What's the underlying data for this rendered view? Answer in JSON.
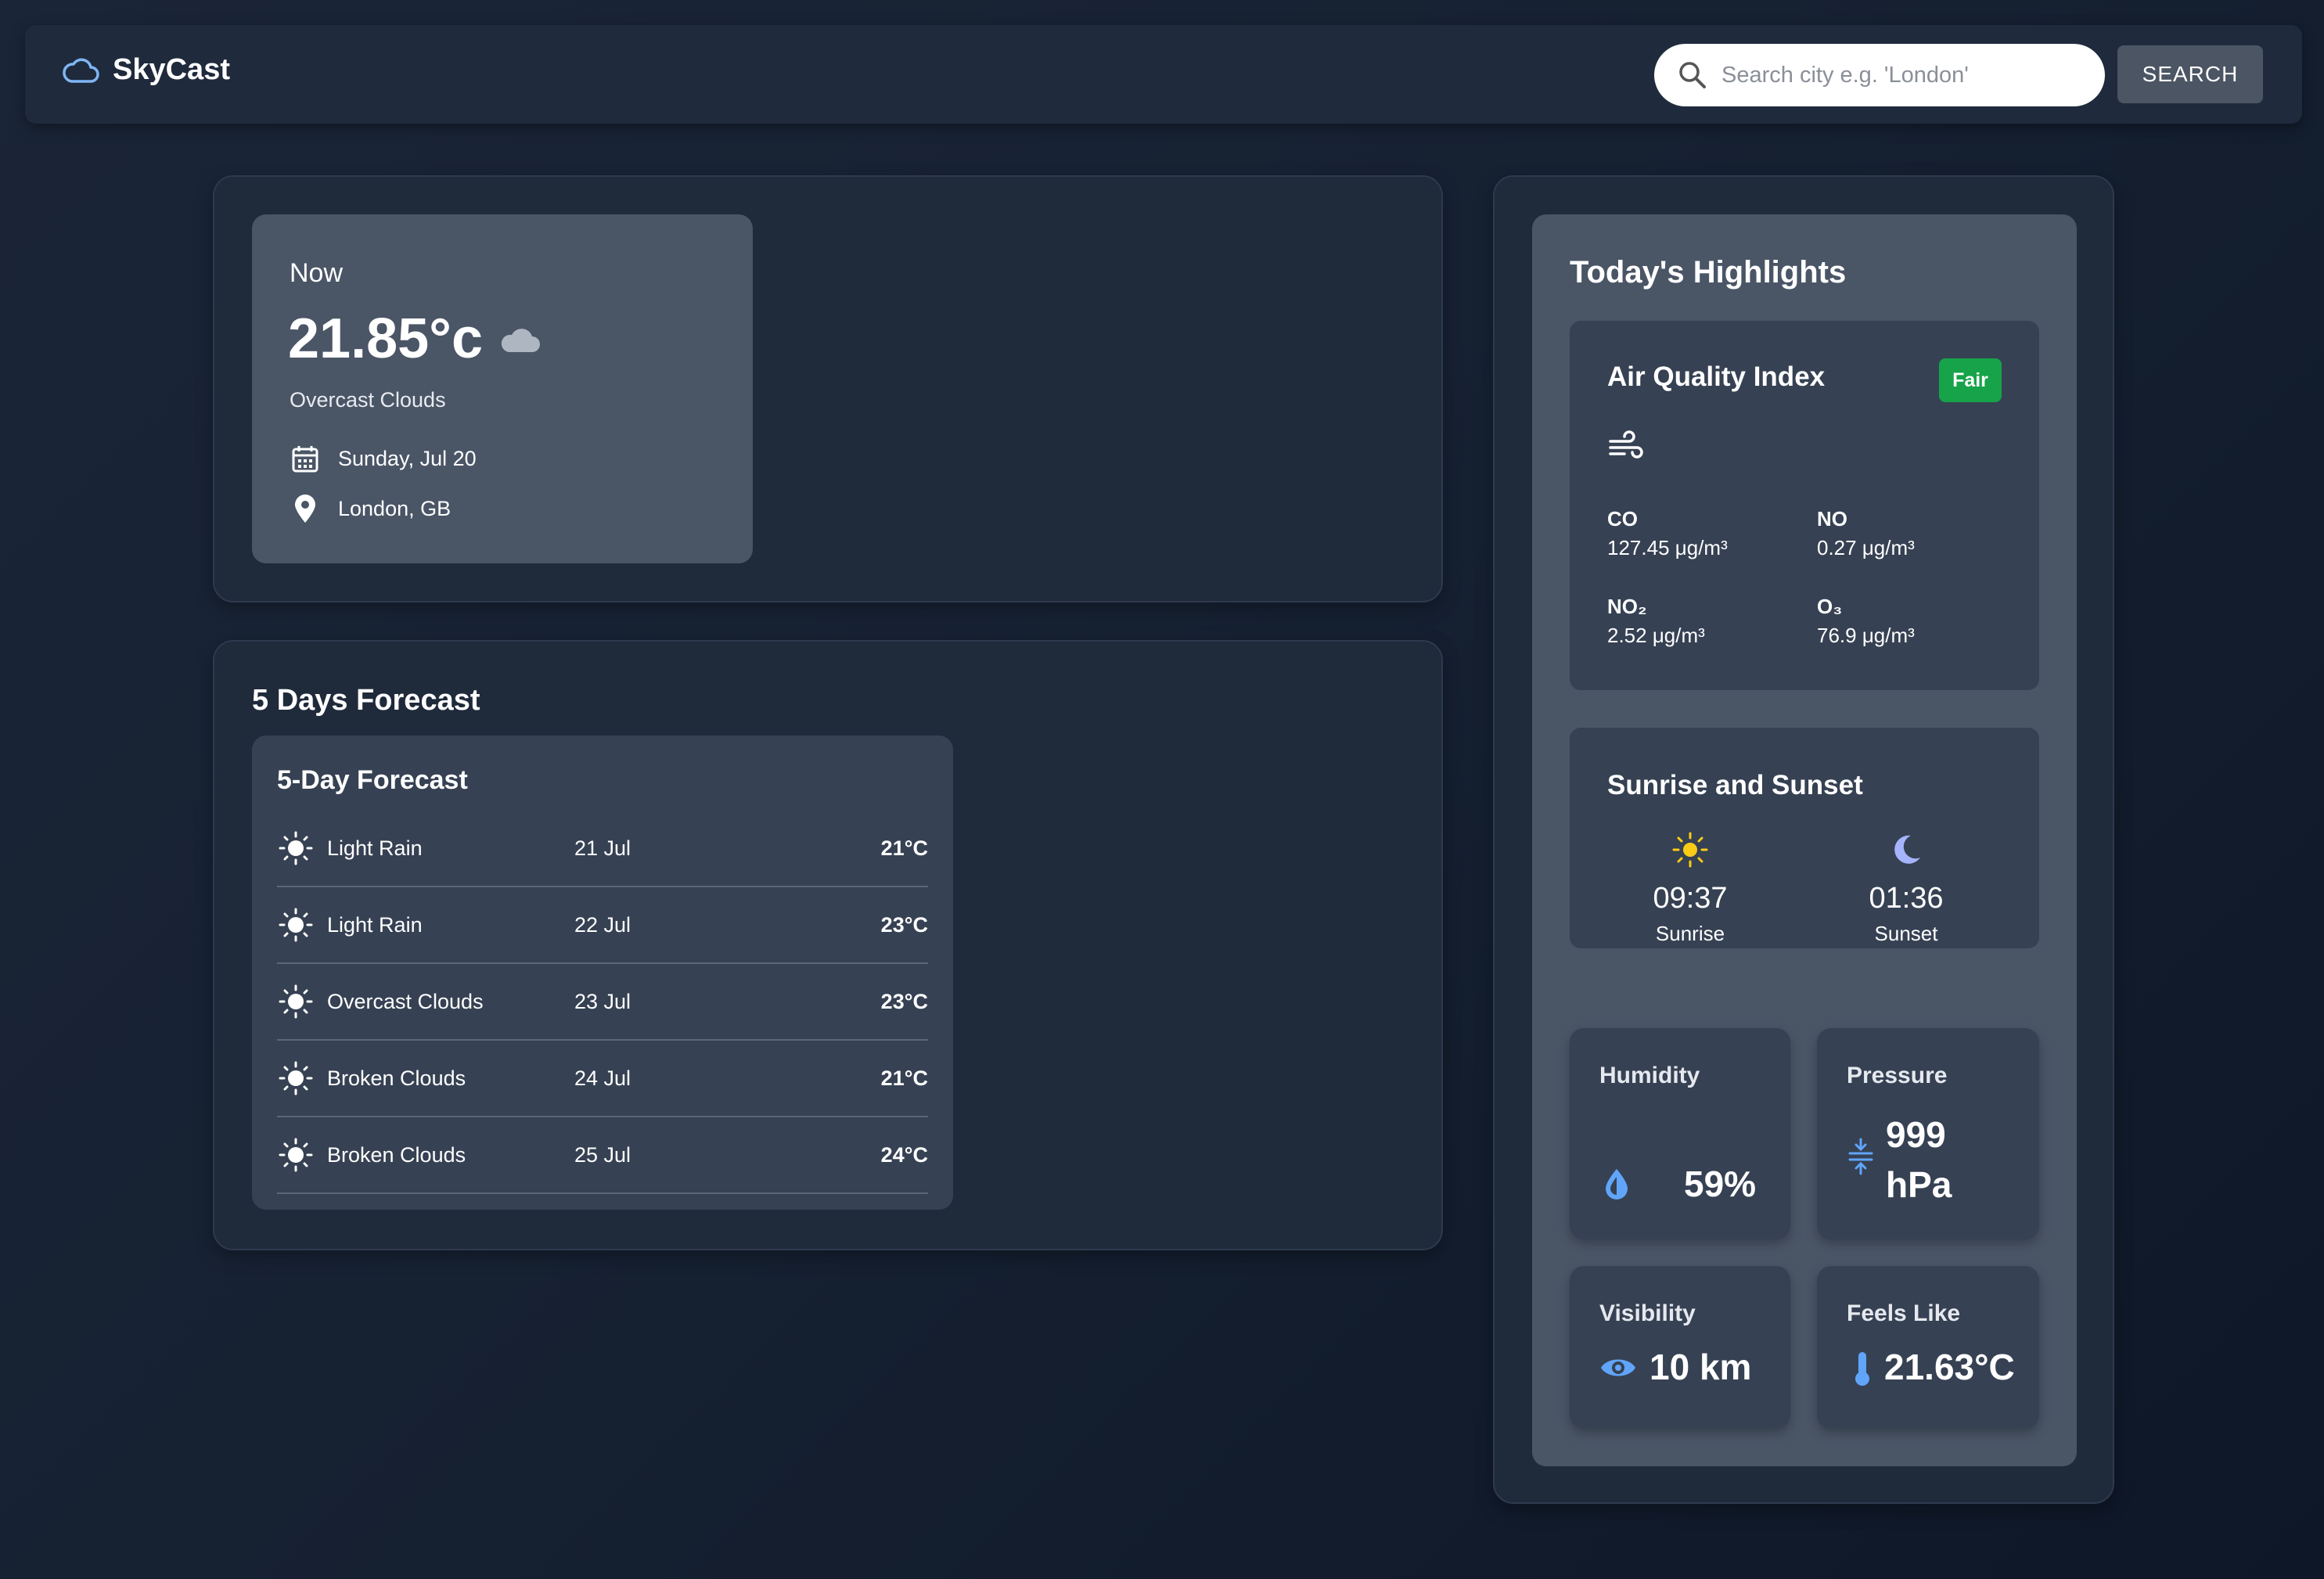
{
  "app": {
    "name": "SkyCast"
  },
  "search": {
    "placeholder": "Search city e.g. 'London'",
    "button_label": "SEARCH"
  },
  "current": {
    "heading": "Now",
    "temperature": "21.85°c",
    "description": "Overcast Clouds",
    "date": "Sunday, Jul 20",
    "location": "London, GB"
  },
  "forecast_section": {
    "title": "5 Days Forecast",
    "card_title": "5-Day Forecast",
    "days": [
      {
        "description": "Light Rain",
        "date": "21 Jul",
        "temp": "21°C"
      },
      {
        "description": "Light Rain",
        "date": "22 Jul",
        "temp": "23°C"
      },
      {
        "description": "Overcast Clouds",
        "date": "23 Jul",
        "temp": "23°C"
      },
      {
        "description": "Broken Clouds",
        "date": "24 Jul",
        "temp": "21°C"
      },
      {
        "description": "Broken Clouds",
        "date": "25 Jul",
        "temp": "24°C"
      }
    ]
  },
  "highlights": {
    "title": "Today's Highlights",
    "air_quality": {
      "title": "Air Quality Index",
      "badge": "Fair",
      "badge_color": "#16a34a",
      "pollutants": [
        {
          "name": "CO",
          "value": "127.45 μg/m³"
        },
        {
          "name": "NO",
          "value": "0.27 μg/m³"
        },
        {
          "name": "NO₂",
          "value": "2.52 μg/m³"
        },
        {
          "name": "O₃",
          "value": "76.9 μg/m³"
        }
      ]
    },
    "sun": {
      "title": "Sunrise and Sunset",
      "sunrise_time": "09:37",
      "sunrise_label": "Sunrise",
      "sunset_time": "01:36",
      "sunset_label": "Sunset"
    },
    "humidity": {
      "label": "Humidity",
      "value": "59%"
    },
    "pressure": {
      "label": "Pressure",
      "value_line1": "999",
      "value_line2": "hPa"
    },
    "visibility": {
      "label": "Visibility",
      "value": "10 km"
    },
    "feels_like": {
      "label": "Feels Like",
      "value": "21.63°C"
    }
  },
  "colors": {
    "accent_blue": "#60a5fa",
    "sun_yellow": "#facc15",
    "moon_purple": "#a5b4fc"
  }
}
